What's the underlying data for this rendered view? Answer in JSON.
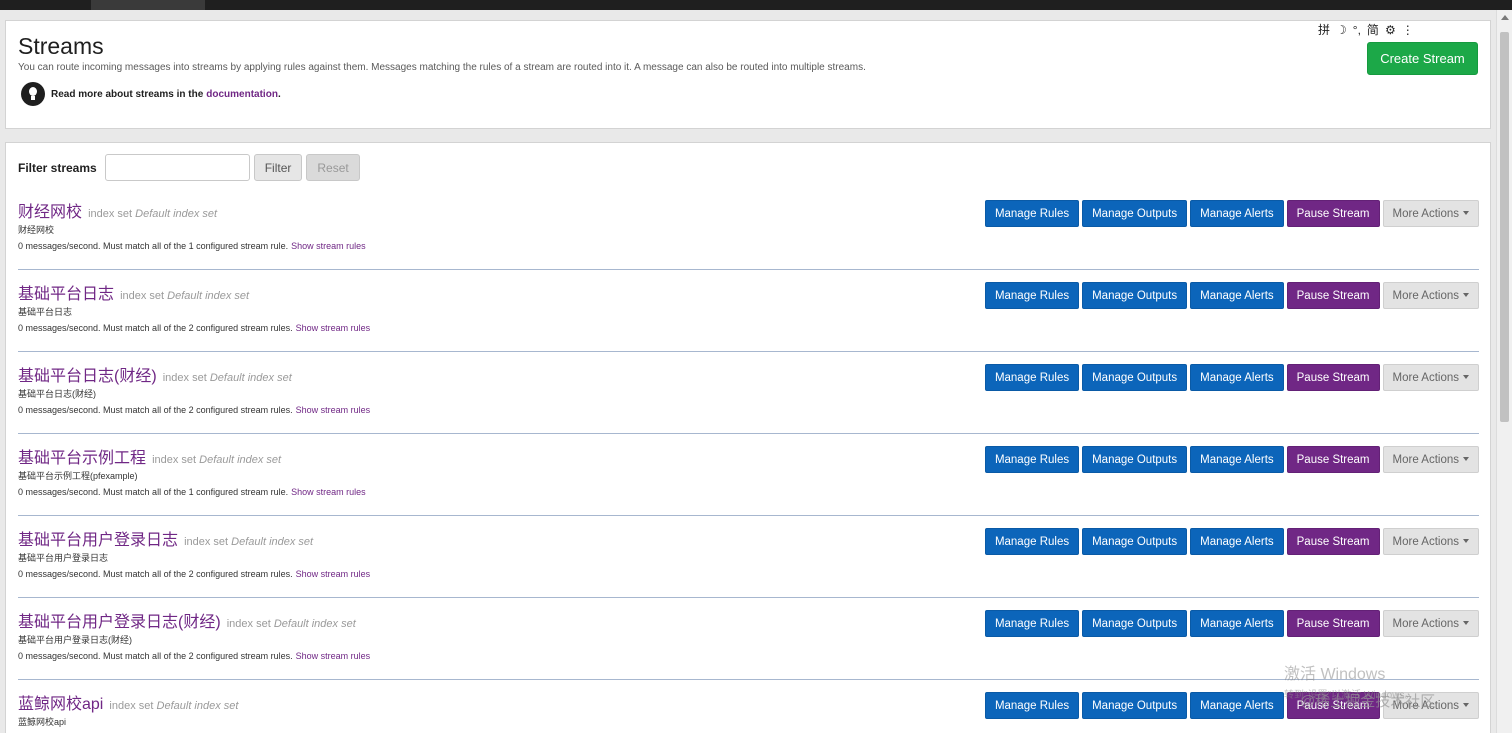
{
  "header": {
    "title": "Streams",
    "description": "You can route incoming messages into streams by applying rules against them. Messages matching the rules of a stream are routed into it. A message can also be routed into multiple streams.",
    "hint_prefix": "Read more about streams in the",
    "hint_link": "documentation",
    "hint_suffix": ".",
    "create_label": "Create Stream",
    "ime_glyphs": [
      "拼",
      "☽",
      "°,",
      "简",
      "⚙",
      "⋮"
    ]
  },
  "filter": {
    "label": "Filter streams",
    "placeholder": "",
    "value": "",
    "filter_label": "Filter",
    "reset_label": "Reset"
  },
  "actions": {
    "manage_rules": "Manage Rules",
    "manage_outputs": "Manage Outputs",
    "manage_alerts": "Manage Alerts",
    "pause_stream": "Pause Stream",
    "more_actions": "More Actions"
  },
  "index_set": {
    "prefix": "index set",
    "name": "Default index set"
  },
  "show_rules_label": "Show stream rules",
  "streams": [
    {
      "title": "财经网校",
      "description": "财经网校",
      "meta": "0 messages/second. Must match all of the 1 configured stream rule."
    },
    {
      "title": "基础平台日志",
      "description": "基础平台日志",
      "meta": "0 messages/second. Must match all of the 2 configured stream rules."
    },
    {
      "title": "基础平台日志(财经)",
      "description": "基础平台日志(财经)",
      "meta": "0 messages/second. Must match all of the 2 configured stream rules."
    },
    {
      "title": "基础平台示例工程",
      "description": "基础平台示例工程(pfexample)",
      "meta": "0 messages/second. Must match all of the 1 configured stream rule."
    },
    {
      "title": "基础平台用户登录日志",
      "description": "基础平台用户登录日志",
      "meta": "0 messages/second. Must match all of the 2 configured stream rules."
    },
    {
      "title": "基础平台用户登录日志(财经)",
      "description": "基础平台用户登录日志(财经)",
      "meta": "0 messages/second. Must match all of the 2 configured stream rules."
    },
    {
      "title": "蓝鲸网校api",
      "description": "蓝鲸网校api",
      "meta": ""
    }
  ],
  "watermark": {
    "line1": "激活 Windows",
    "line2": "转到\"设置\"以激活 Windows。",
    "line3": "@稀土掘金技术社区"
  },
  "colors": {
    "primary": "#0c65ba",
    "accent": "#702785",
    "success": "#1ca848"
  }
}
